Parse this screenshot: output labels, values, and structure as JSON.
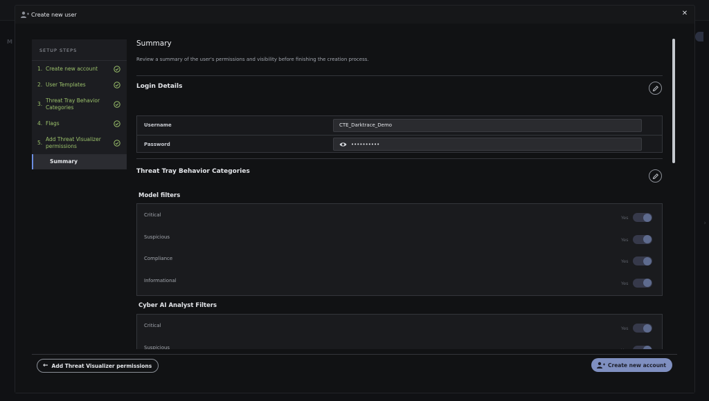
{
  "modal": {
    "title": "Create new user",
    "close_icon": "close-icon"
  },
  "steps": {
    "title": "SETUP STEPS",
    "items": [
      {
        "num": "1.",
        "label": "Create new account",
        "done": true
      },
      {
        "num": "2.",
        "label": "User Templates",
        "done": true
      },
      {
        "num": "3.",
        "label": "Threat Tray Behavior Categories",
        "done": true
      },
      {
        "num": "4.",
        "label": "Flags",
        "done": true
      },
      {
        "num": "5.",
        "label": "Add Threat Visualizer permissions",
        "done": true
      },
      {
        "num": "",
        "label": "Summary",
        "done": false,
        "active": true
      }
    ]
  },
  "summary": {
    "title": "Summary",
    "description": "Review a summary of the user's permissions and visibility before finishing the creation process."
  },
  "login": {
    "title": "Login Details",
    "username_label": "Username",
    "username_value": "CTE_Darktrace_Demo",
    "password_label": "Password",
    "password_value": "••••••••••"
  },
  "threat_tray": {
    "title": "Threat Tray Behavior Categories",
    "model_filters": {
      "title": "Model filters",
      "rows": [
        {
          "label": "Critical",
          "value": "Yes",
          "on": true
        },
        {
          "label": "Suspicious",
          "value": "Yes",
          "on": true
        },
        {
          "label": "Compliance",
          "value": "Yes",
          "on": true
        },
        {
          "label": "Informational",
          "value": "Yes",
          "on": true
        }
      ]
    },
    "analyst_filters": {
      "title": "Cyber AI Analyst Filters",
      "rows": [
        {
          "label": "Critical",
          "value": "Yes",
          "on": true
        },
        {
          "label": "Suspicious",
          "value": "Yes",
          "on": true
        }
      ]
    }
  },
  "footer": {
    "back_label": "Add Threat Visualizer permissions",
    "create_label": "Create new account"
  },
  "colors": {
    "accent": "#7f8fc0",
    "step_done": "#9bc16b",
    "active_indicator": "#6b8de0"
  }
}
